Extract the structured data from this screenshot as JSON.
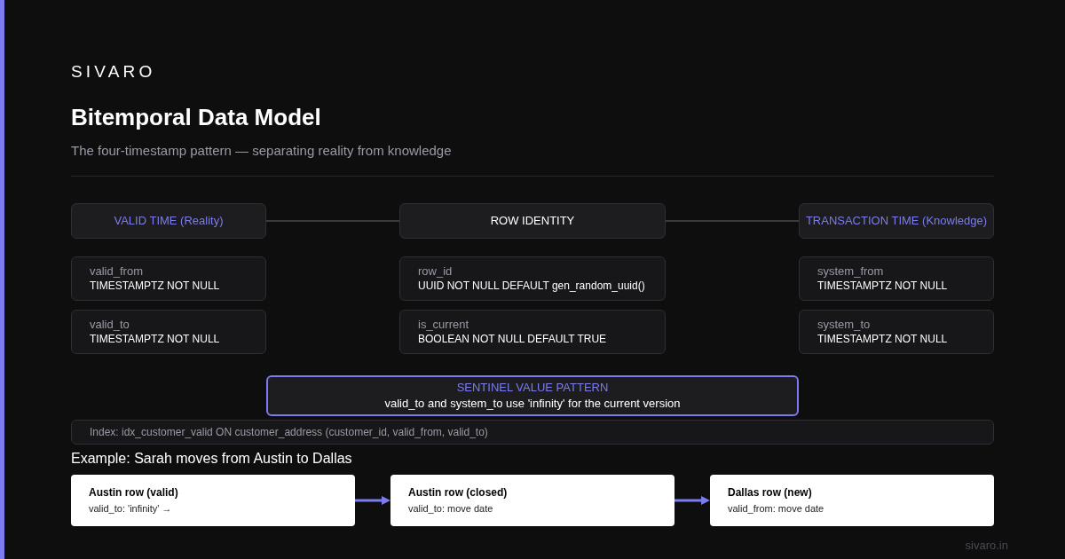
{
  "brand": "SIVARO",
  "title": "Bitemporal Data Model",
  "subtitle": "The four-timestamp pattern — separating reality from knowledge",
  "groups": [
    {
      "title": "VALID TIME (Reality)",
      "highlighted": true,
      "fields": [
        {
          "name": "valid_from",
          "type": "TIMESTAMPTZ NOT NULL"
        },
        {
          "name": "valid_to",
          "type": "TIMESTAMPTZ NOT NULL"
        }
      ]
    },
    {
      "title": "ROW IDENTITY",
      "highlighted": false,
      "fields": [
        {
          "name": "row_id",
          "type": "UUID NOT NULL DEFAULT gen_random_uuid()"
        },
        {
          "name": "is_current",
          "type": "BOOLEAN NOT NULL DEFAULT TRUE"
        }
      ]
    },
    {
      "title": "TRANSACTION TIME (Knowledge)",
      "highlighted": true,
      "fields": [
        {
          "name": "system_from",
          "type": "TIMESTAMPTZ NOT NULL"
        },
        {
          "name": "system_to",
          "type": "TIMESTAMPTZ NOT NULL"
        }
      ]
    }
  ],
  "sentinel": {
    "title": "SENTINEL VALUE PATTERN",
    "text": "valid_to and system_to use 'infinity' for the current version"
  },
  "index_note": "Index: idx_customer_valid ON customer_address (customer_id, valid_from, valid_to)",
  "example": {
    "title": "Example: Sarah moves from Austin to Dallas",
    "steps": [
      {
        "title": "Austin row (valid)",
        "detail": "valid_to: 'infinity' →"
      },
      {
        "title": "Austin row (closed)",
        "detail": "valid_to: move date"
      },
      {
        "title": "Dallas row (new)",
        "detail": "valid_from: move date"
      }
    ]
  },
  "footer": "sivaro.in"
}
